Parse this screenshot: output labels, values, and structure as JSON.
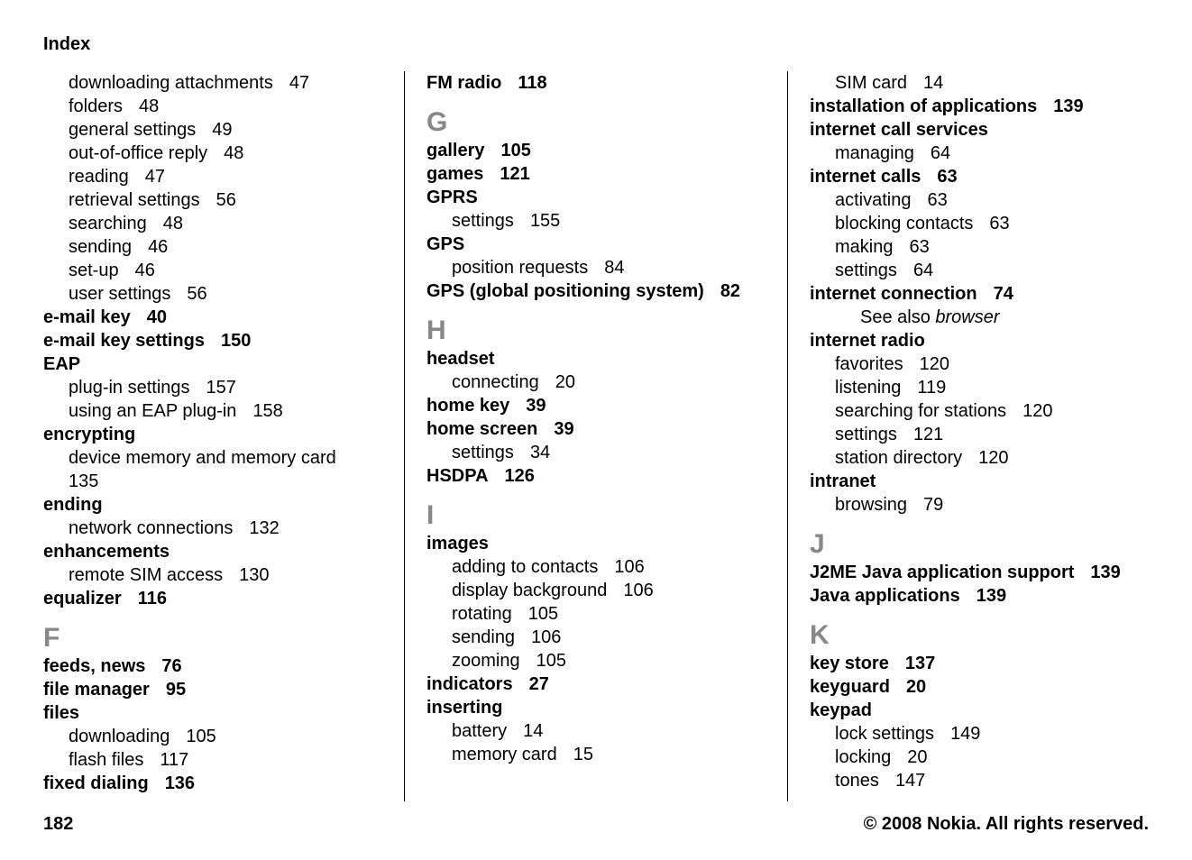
{
  "header": "Index",
  "footer": {
    "page": "182",
    "copyright": "© 2008 Nokia. All rights reserved."
  },
  "col1": {
    "pre": [
      {
        "text": "downloading attachments",
        "page": "47",
        "cls": "sub"
      },
      {
        "text": "folders",
        "page": "48",
        "cls": "sub"
      },
      {
        "text": "general settings",
        "page": "49",
        "cls": "sub"
      },
      {
        "text": "out-of-office reply",
        "page": "48",
        "cls": "sub"
      },
      {
        "text": "reading",
        "page": "47",
        "cls": "sub"
      },
      {
        "text": "retrieval settings",
        "page": "56",
        "cls": "sub"
      },
      {
        "text": "searching",
        "page": "48",
        "cls": "sub"
      },
      {
        "text": "sending",
        "page": "46",
        "cls": "sub"
      },
      {
        "text": "set-up",
        "page": "46",
        "cls": "sub"
      },
      {
        "text": "user settings",
        "page": "56",
        "cls": "sub"
      },
      {
        "text": "e-mail key",
        "page": "40",
        "cls": "topic"
      },
      {
        "text": "e-mail key settings",
        "page": "150",
        "cls": "topic"
      },
      {
        "text": "EAP",
        "page": "",
        "cls": "topic"
      },
      {
        "text": "plug-in settings",
        "page": "157",
        "cls": "sub"
      },
      {
        "text": "using an EAP plug-in",
        "page": "158",
        "cls": "sub"
      },
      {
        "text": "encrypting",
        "page": "",
        "cls": "topic"
      },
      {
        "text": "device memory and memory card",
        "page": "135",
        "cls": "sub"
      },
      {
        "text": "ending",
        "page": "",
        "cls": "topic"
      },
      {
        "text": "network connections",
        "page": "132",
        "cls": "sub"
      },
      {
        "text": "enhancements",
        "page": "",
        "cls": "topic"
      },
      {
        "text": "remote SIM access",
        "page": "130",
        "cls": "sub"
      },
      {
        "text": "equalizer",
        "page": "116",
        "cls": "topic"
      }
    ],
    "F_letter": "F",
    "F": [
      {
        "text": "feeds, news",
        "page": "76",
        "cls": "topic"
      },
      {
        "text": "file manager",
        "page": "95",
        "cls": "topic"
      },
      {
        "text": "files",
        "page": "",
        "cls": "topic"
      },
      {
        "text": "downloading",
        "page": "105",
        "cls": "sub"
      },
      {
        "text": "flash files",
        "page": "117",
        "cls": "sub"
      },
      {
        "text": "fixed dialing",
        "page": "136",
        "cls": "topic"
      }
    ]
  },
  "col2": {
    "pre": [
      {
        "text": "FM radio",
        "page": "118",
        "cls": "topic"
      }
    ],
    "G_letter": "G",
    "G": [
      {
        "text": "gallery",
        "page": "105",
        "cls": "topic"
      },
      {
        "text": "games",
        "page": "121",
        "cls": "topic"
      },
      {
        "text": "GPRS",
        "page": "",
        "cls": "topic"
      },
      {
        "text": "settings",
        "page": "155",
        "cls": "sub"
      },
      {
        "text": "GPS",
        "page": "",
        "cls": "topic"
      },
      {
        "text": "position requests",
        "page": "84",
        "cls": "sub"
      },
      {
        "text": "GPS (global positioning system)",
        "page": "82",
        "cls": "topic"
      }
    ],
    "H_letter": "H",
    "H": [
      {
        "text": "headset",
        "page": "",
        "cls": "topic"
      },
      {
        "text": "connecting",
        "page": "20",
        "cls": "sub"
      },
      {
        "text": "home key",
        "page": "39",
        "cls": "topic"
      },
      {
        "text": "home screen",
        "page": "39",
        "cls": "topic"
      },
      {
        "text": "settings",
        "page": "34",
        "cls": "sub"
      },
      {
        "text": "HSDPA",
        "page": "126",
        "cls": "topic"
      }
    ],
    "I_letter": "I",
    "I": [
      {
        "text": "images",
        "page": "",
        "cls": "topic"
      },
      {
        "text": "adding to contacts",
        "page": "106",
        "cls": "sub"
      },
      {
        "text": "display background",
        "page": "106",
        "cls": "sub"
      },
      {
        "text": "rotating",
        "page": "105",
        "cls": "sub"
      },
      {
        "text": "sending",
        "page": "106",
        "cls": "sub"
      },
      {
        "text": "zooming",
        "page": "105",
        "cls": "sub"
      },
      {
        "text": "indicators",
        "page": "27",
        "cls": "topic"
      },
      {
        "text": "inserting",
        "page": "",
        "cls": "topic"
      },
      {
        "text": "battery",
        "page": "14",
        "cls": "sub"
      },
      {
        "text": "memory card",
        "page": "15",
        "cls": "sub"
      }
    ]
  },
  "col3": {
    "pre": [
      {
        "text": "SIM card",
        "page": "14",
        "cls": "sub"
      },
      {
        "text": "installation of applications",
        "page": "139",
        "cls": "topic"
      },
      {
        "text": "internet call services",
        "page": "",
        "cls": "topic"
      },
      {
        "text": "managing",
        "page": "64",
        "cls": "sub"
      },
      {
        "text": "internet calls",
        "page": "63",
        "cls": "topic"
      },
      {
        "text": "activating",
        "page": "63",
        "cls": "sub"
      },
      {
        "text": "blocking contacts",
        "page": "63",
        "cls": "sub"
      },
      {
        "text": "making",
        "page": "63",
        "cls": "sub"
      },
      {
        "text": "settings",
        "page": "64",
        "cls": "sub"
      },
      {
        "text": "internet connection",
        "page": "74",
        "cls": "topic"
      },
      {
        "text_pre": "See also ",
        "text_it": "browser",
        "page": "",
        "cls": "sub2",
        "seealso": true
      },
      {
        "text": "internet radio",
        "page": "",
        "cls": "topic"
      },
      {
        "text": "favorites",
        "page": "120",
        "cls": "sub"
      },
      {
        "text": "listening",
        "page": "119",
        "cls": "sub"
      },
      {
        "text": "searching for stations",
        "page": "120",
        "cls": "sub"
      },
      {
        "text": "settings",
        "page": "121",
        "cls": "sub"
      },
      {
        "text": "station directory",
        "page": "120",
        "cls": "sub"
      },
      {
        "text": "intranet",
        "page": "",
        "cls": "topic"
      },
      {
        "text": "browsing",
        "page": "79",
        "cls": "sub"
      }
    ],
    "J_letter": "J",
    "J": [
      {
        "text": "J2ME Java application support",
        "page": "139",
        "cls": "topic"
      },
      {
        "text": "Java applications",
        "page": "139",
        "cls": "topic"
      }
    ],
    "K_letter": "K",
    "K": [
      {
        "text": "key store",
        "page": "137",
        "cls": "topic"
      },
      {
        "text": "keyguard",
        "page": "20",
        "cls": "topic"
      },
      {
        "text": "keypad",
        "page": "",
        "cls": "topic"
      },
      {
        "text": "lock settings",
        "page": "149",
        "cls": "sub"
      },
      {
        "text": "locking",
        "page": "20",
        "cls": "sub"
      },
      {
        "text": "tones",
        "page": "147",
        "cls": "sub"
      }
    ]
  }
}
